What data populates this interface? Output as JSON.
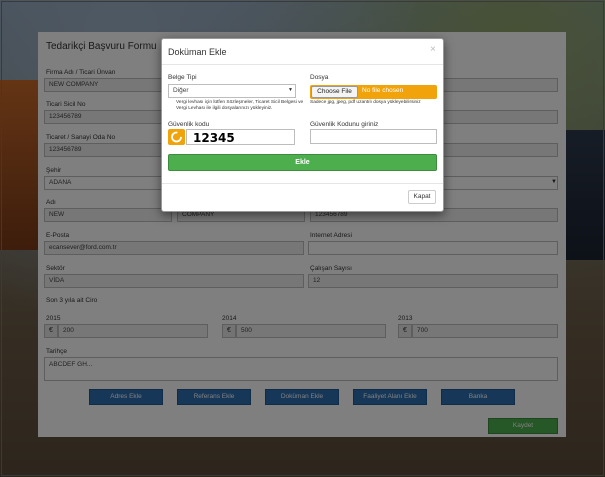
{
  "form": {
    "title": "Tedarikçi Başvuru Formu",
    "fields": {
      "company_name_label": "Firma Adı / Ticari Ünvan",
      "company_name_value": "NEW COMPANY",
      "tax_no_label": "Ticari Sicil No",
      "tax_no_value": "123456789",
      "chamber_no_label": "Ticaret / Sanayi Oda No",
      "chamber_no_value": "123456789",
      "city_label": "Şehir",
      "city_value": "ADANA",
      "name_label": "Adı",
      "name_value": "NEW",
      "surname_value": "COMPANY",
      "phone_value": "123456789",
      "email_label": "E-Posta",
      "email_value": "ecansever@ford.com.tr",
      "website_label": "Internet Adresi",
      "sector_label": "Sektör",
      "sector_value": "VİDA",
      "employees_label": "Çalışan Sayısı",
      "employees_value": "12",
      "revenue_label": "Son 3 yıla ait Ciro",
      "year1_label": "2015",
      "year1_value": "200",
      "year2_label": "2014",
      "year2_value": "500",
      "year3_label": "2013",
      "year3_value": "700",
      "currency_symbol": "€",
      "history_label": "Tarihçe",
      "history_value": "ABCDEF GH..."
    },
    "buttons": {
      "address": "Adres Ekle",
      "reference": "Referans Ekle",
      "document": "Doküman Ekle",
      "activity": "Faaliyet Alanı Ekle",
      "bank": "Banka",
      "save": "Kaydet"
    }
  },
  "modal": {
    "title": "Doküman Ekle",
    "close_symbol": "×",
    "doc_type_label": "Belge Tipi",
    "doc_type_value": "Diğer",
    "doc_type_help": "Vergi levhası için lütfen Sözleşmeler, Ticaret Sicil Belgesi ve Vergi Levhası ile ilgili dosyalarınızı yükleyiniz.",
    "file_label": "Dosya",
    "file_button": "Choose File",
    "file_status": "No file chosen",
    "file_help": "Sadece jpg, jpeg, pdf uzantılı dosya yükleyebilirsiniz",
    "captcha_label": "Güvenlik kodu",
    "captcha_code": "12345",
    "captcha_input_label": "Güvenlik Kodunu giriniz",
    "submit_button": "Ekle",
    "cancel_button": "Kapat"
  },
  "colors": {
    "primary_blue": "#2f6fb0",
    "success_green": "#4cae4c",
    "warning_orange": "#f0a30a"
  }
}
